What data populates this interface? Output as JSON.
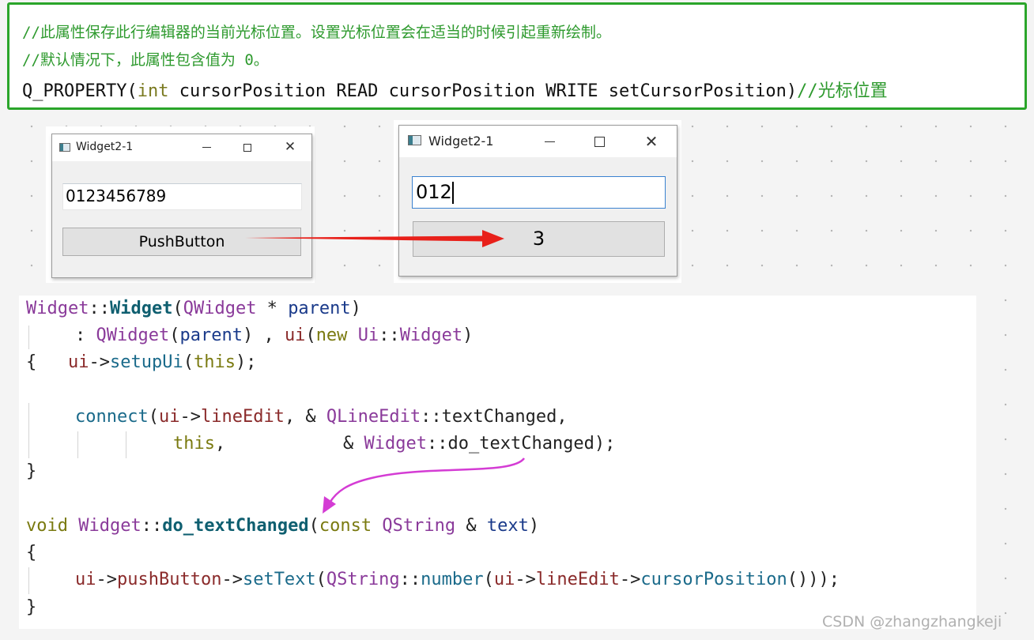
{
  "top_code": {
    "comment1": "//此属性保存此行编辑器的当前光标位置。设置光标位置会在适当的时候引起重新绘制。",
    "comment2": "//默认情况下，此属性包含值为 0。",
    "decl_pre": "Q_PROPERTY(",
    "decl_int": "int",
    "decl_rest": " cursorPosition READ cursorPosition WRITE setCursorPosition)",
    "decl_comment": "//光标位置"
  },
  "window_left": {
    "title": "Widget2-1",
    "line_edit_value": "0123456789",
    "push_button_label": "PushButton"
  },
  "window_right": {
    "title": "Widget2-1",
    "line_edit_value": "012",
    "push_button_label": "3"
  },
  "code": {
    "l1": {
      "a": "Widget",
      "b": "::",
      "c": "Widget",
      "d": "(",
      "e": "QWidget",
      "f": " * ",
      "g": "parent",
      "h": ")"
    },
    "l2": {
      "a": ": ",
      "b": "QWidget",
      "c": "(",
      "d": "parent",
      "e": ") , ",
      "f": "ui",
      "g": "(",
      "h": "new",
      "i": " ",
      "j": "Ui",
      "k": "::",
      "l": "Widget",
      "m": ")"
    },
    "l3": {
      "a": "{   ",
      "b": "ui",
      "c": "->",
      "d": "setupUi",
      "e": "(",
      "f": "this",
      "g": ");"
    },
    "l5": {
      "a": "connect",
      "b": "(",
      "c": "ui",
      "d": "->",
      "e": "lineEdit",
      "f": ", & ",
      "g": "QLineEdit",
      "h": "::",
      "i": "textChanged",
      "j": ","
    },
    "l6": {
      "a": "this",
      "b": ",",
      "c": "& ",
      "d": "Widget",
      "e": "::",
      "f": "do_textChanged",
      "g": ");"
    },
    "l7": "}",
    "l9": {
      "a": "void",
      "b": " ",
      "c": "Widget",
      "d": "::",
      "e": "do_textChanged",
      "f": "(",
      "g": "const",
      "h": " ",
      "i": "QString",
      "j": " & ",
      "k": "text",
      "l": ")"
    },
    "l10": "{",
    "l11": {
      "a": "ui",
      "b": "->",
      "c": "pushButton",
      "d": "->",
      "e": "setText",
      "f": "(",
      "g": "QString",
      "h": "::",
      "i": "number",
      "j": "(",
      "k": "ui",
      "l": "->",
      "m": "lineEdit",
      "n": "->",
      "o": "cursorPosition",
      "p": "()));"
    },
    "l12": "}"
  },
  "watermark": "CSDN @zhangzhangkeji",
  "colors": {
    "border_green": "#2aa52a",
    "arrow_red": "#e8201a",
    "arrow_magenta": "#d43cd4"
  }
}
